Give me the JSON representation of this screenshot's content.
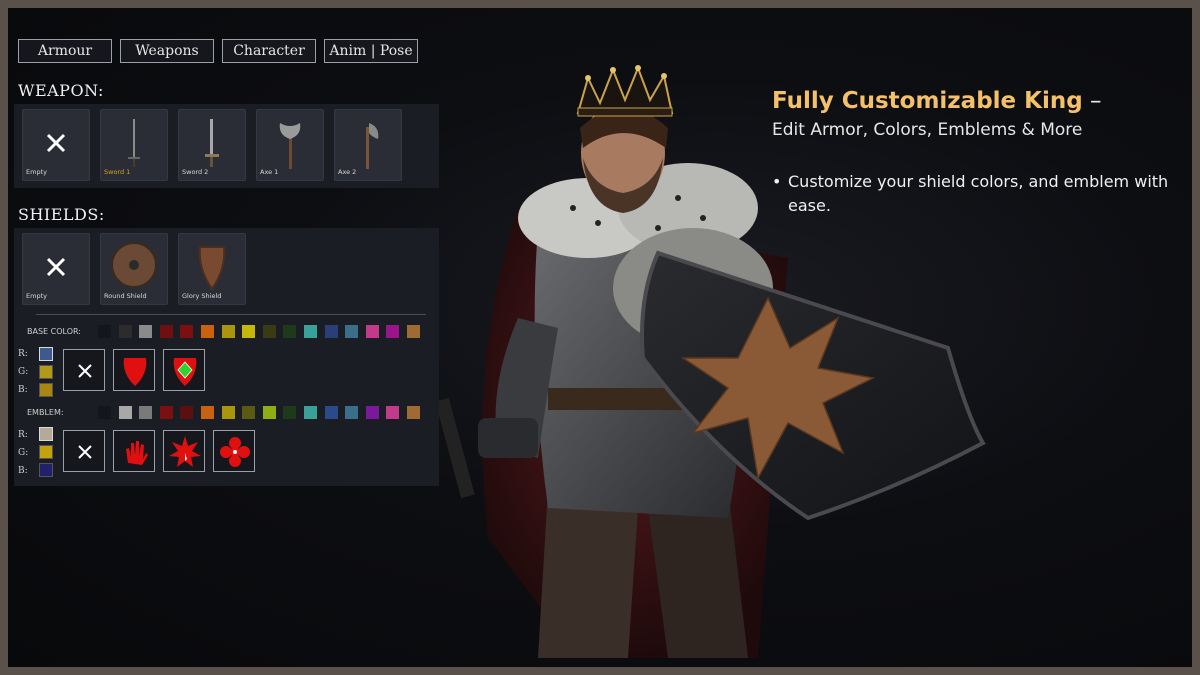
{
  "tabs": [
    {
      "label": "Armour"
    },
    {
      "label": "Weapons"
    },
    {
      "label": "Character"
    },
    {
      "label": "Anim | Pose"
    }
  ],
  "weapon": {
    "title": "WEAPON:",
    "items": [
      {
        "label": "Empty",
        "icon": "x-icon",
        "selected": false
      },
      {
        "label": "Sword 1",
        "icon": "sword-icon",
        "selected": true
      },
      {
        "label": "Sword 2",
        "icon": "sword-icon",
        "selected": false
      },
      {
        "label": "Axe 1",
        "icon": "axe-icon",
        "selected": false
      },
      {
        "label": "Axe 2",
        "icon": "axe-icon",
        "selected": false
      }
    ]
  },
  "shields": {
    "title": "SHIELDS:",
    "items": [
      {
        "label": "Empty",
        "icon": "x-icon"
      },
      {
        "label": "Round Shield",
        "icon": "round-shield-icon"
      },
      {
        "label": "Glory Shield",
        "icon": "glory-shield-icon"
      }
    ]
  },
  "base_color": {
    "label": "BASE COLOR:",
    "swatches": [
      "#15161c",
      "#2c2c2c",
      "#8a8a8a",
      "#6e0f12",
      "#7a1010",
      "#c8620e",
      "#a8960c",
      "#c4b80a",
      "#3a3a14",
      "#1e3a1a",
      "#3aa09a",
      "#2a3f7a",
      "#3a6e8a",
      "#c23a8a",
      "#9a148a",
      "#a06a34"
    ],
    "rgb": {
      "r_label": "R:",
      "g_label": "G:",
      "b_label": "B:",
      "r_color": "#3d5a8e",
      "g_color": "#b39a16",
      "b_color": "#a8860f",
      "selected": "r"
    },
    "options": [
      "none-icon",
      "shield-red-icon",
      "shield-diamond-icon"
    ]
  },
  "emblem": {
    "label": "EMBLEM:",
    "swatches": [
      "#15161c",
      "#a8a8a8",
      "#7a7a7a",
      "#7a1010",
      "#5a1010",
      "#c8620e",
      "#a8960c",
      "#5a5a10",
      "#8fae14",
      "#1e3a1a",
      "#3aa09a",
      "#2a4a8a",
      "#3a6e8a",
      "#7a1a9a",
      "#c23a8a",
      "#a06a34"
    ],
    "rgb": {
      "r_label": "R:",
      "g_label": "G:",
      "b_label": "B:",
      "r_color": "#b5aa9a",
      "g_color": "#c4a20e",
      "b_color": "#22206a",
      "selected": "r"
    },
    "options": [
      "none-icon",
      "hand-emblem-icon",
      "star-emblem-icon",
      "flower-emblem-icon"
    ]
  },
  "promo": {
    "headline": "Fully Customizable King",
    "dash": " –",
    "subhead": "Edit Armor, Colors, Emblems & More",
    "bullet": "Customize your shield colors, and emblem with ease.",
    "accent": "#f4c16a"
  }
}
